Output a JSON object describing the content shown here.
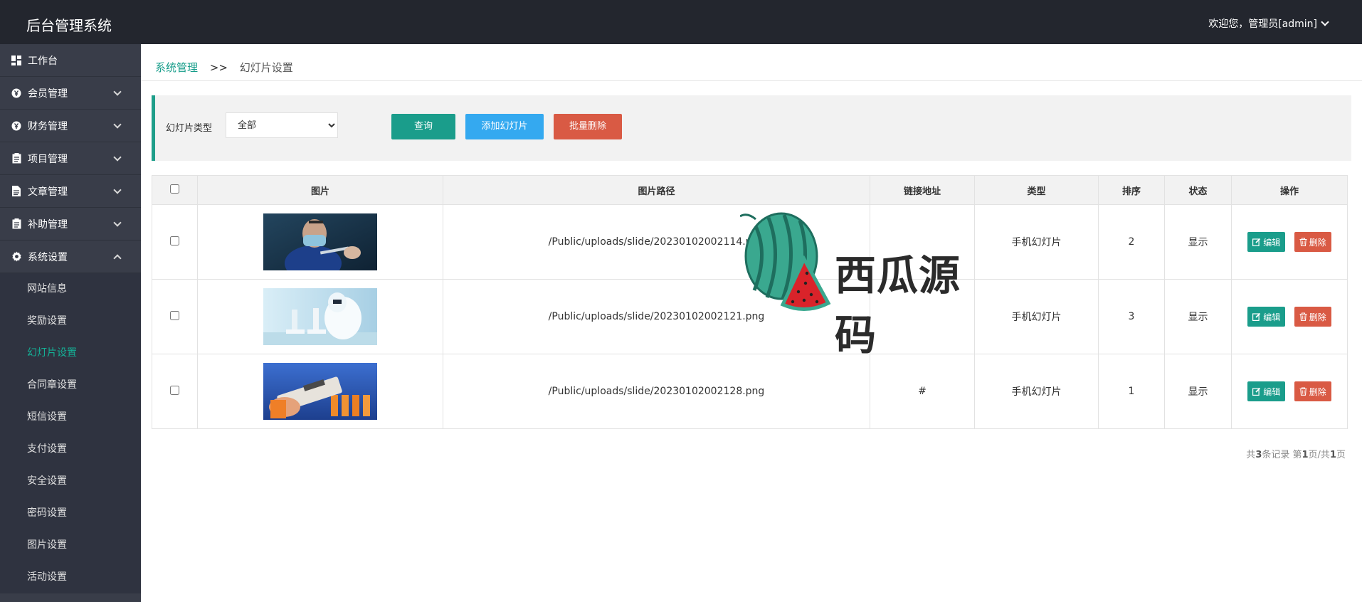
{
  "header": {
    "title": "后台管理系统",
    "user": "欢迎您，管理员[admin]"
  },
  "sidebar": {
    "items": [
      {
        "label": "工作台",
        "icon": "dashboard-icon"
      },
      {
        "label": "会员管理",
        "icon": "yen-circle-icon"
      },
      {
        "label": "财务管理",
        "icon": "yen-circle-icon"
      },
      {
        "label": "项目管理",
        "icon": "clipboard-icon"
      },
      {
        "label": "文章管理",
        "icon": "document-icon"
      },
      {
        "label": "补助管理",
        "icon": "clipboard-icon"
      },
      {
        "label": "系统设置",
        "icon": "gear-icon"
      }
    ],
    "sub_items": [
      "网站信息",
      "奖励设置",
      "幻灯片设置",
      "合同章设置",
      "短信设置",
      "支付设置",
      "安全设置",
      "密码设置",
      "图片设置",
      "活动设置"
    ],
    "active_sub": "幻灯片设置"
  },
  "breadcrumb": {
    "parent": "系统管理",
    "sep": ">>",
    "current": "幻灯片设置"
  },
  "filter": {
    "label": "幻灯片类型",
    "select_value": "全部",
    "query_label": "查询",
    "add_label": "添加幻灯片",
    "batch_delete_label": "批量删除"
  },
  "table": {
    "headers": [
      "图片",
      "图片路径",
      "链接地址",
      "类型",
      "排序",
      "状态",
      "操作"
    ],
    "rows": [
      {
        "path": "/Public/uploads/slide/20230102002114.png",
        "link": "",
        "type": "手机幻灯片",
        "sort": "2",
        "status": "显示"
      },
      {
        "path": "/Public/uploads/slide/20230102002121.png",
        "link": "",
        "type": "手机幻灯片",
        "sort": "3",
        "status": "显示"
      },
      {
        "path": "/Public/uploads/slide/20230102002128.png",
        "link": "#",
        "type": "手机幻灯片",
        "sort": "1",
        "status": "显示"
      }
    ],
    "edit_label": "编辑",
    "delete_label": "删除"
  },
  "pager": {
    "prefix": "共",
    "total": "3",
    "mid": "条记录 第",
    "page": "1",
    "mid2": "页/共",
    "pages": "1",
    "suffix": "页"
  },
  "watermark": {
    "text": "西瓜源码"
  },
  "colors": {
    "accent": "#1a9d8b",
    "primary": "#34a9f0",
    "danger": "#d95a44",
    "sidebar": "#393d49",
    "topbar": "#23262e"
  }
}
